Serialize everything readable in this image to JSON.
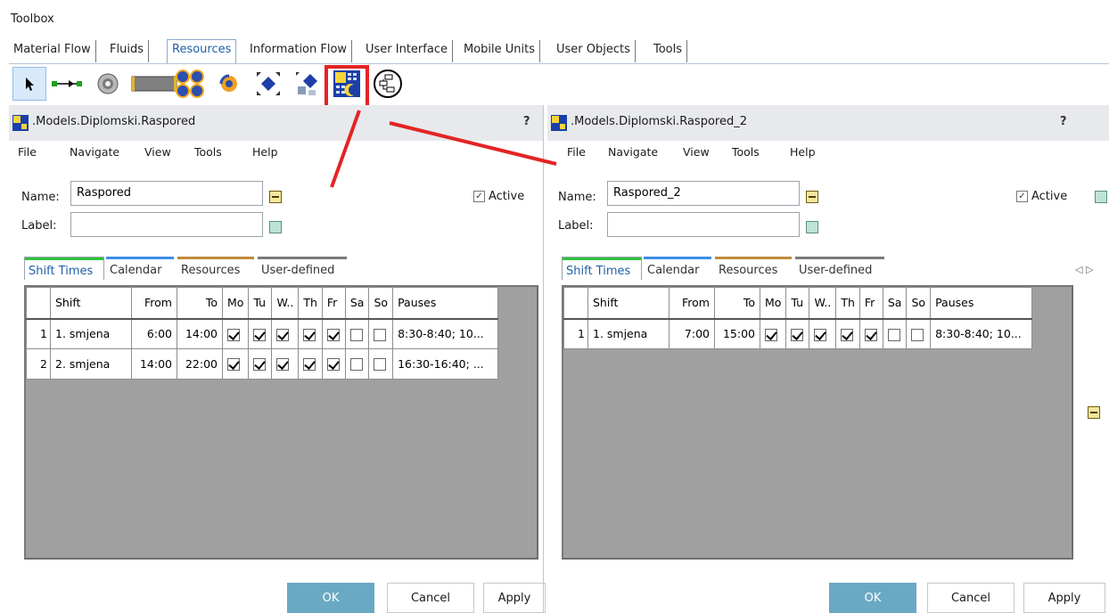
{
  "toolbox": {
    "title": "Toolbox",
    "tabs": [
      "Material Flow",
      "Fluids",
      "Resources",
      "Information Flow",
      "User Interface",
      "Mobile Units",
      "User Objects",
      "Tools"
    ],
    "active_tab": "Resources"
  },
  "tools": [
    "pointer-icon",
    "connector-icon",
    "worker-pool-icon",
    "broker-icon",
    "exporter-icon",
    "footpath-icon",
    "worker-icon",
    "exchange-icon",
    "shift-calendar-icon",
    "workplace-icon"
  ],
  "windows": [
    {
      "title": ".Models.Diplomski.Raspored",
      "help": "?",
      "menu": [
        "File",
        "Navigate",
        "View",
        "Tools",
        "Help"
      ],
      "name_label": "Name:",
      "name_value": "Raspored",
      "label_label": "Label:",
      "label_value": "",
      "active_label": "Active",
      "tabs": [
        "Shift Times",
        "Calendar",
        "Resources",
        "User-defined"
      ],
      "columns": [
        "Shift",
        "From",
        "To",
        "Mo",
        "Tu",
        "W..",
        "Th",
        "Fr",
        "Sa",
        "So",
        "Pauses"
      ],
      "rows": [
        {
          "n": "1",
          "shift": "1. smjena",
          "from": "6:00",
          "to": "14:00",
          "days": [
            true,
            true,
            true,
            true,
            true,
            false,
            false
          ],
          "pauses": "8:30-8:40; 10..."
        },
        {
          "n": "2",
          "shift": "2. smjena",
          "from": "14:00",
          "to": "22:00",
          "days": [
            true,
            true,
            true,
            true,
            true,
            false,
            false
          ],
          "pauses": "16:30-16:40; ..."
        }
      ],
      "buttons": {
        "ok": "OK",
        "cancel": "Cancel",
        "apply": "Apply"
      }
    },
    {
      "title": ".Models.Diplomski.Raspored_2",
      "help": "?",
      "menu": [
        "File",
        "Navigate",
        "View",
        "Tools",
        "Help"
      ],
      "name_label": "Name:",
      "name_value": "Raspored_2",
      "label_label": "Label:",
      "label_value": "",
      "active_label": "Active",
      "tabs": [
        "Shift Times",
        "Calendar",
        "Resources",
        "User-defined"
      ],
      "columns": [
        "Shift",
        "From",
        "To",
        "Mo",
        "Tu",
        "W..",
        "Th",
        "Fr",
        "Sa",
        "So",
        "Pauses"
      ],
      "rows": [
        {
          "n": "1",
          "shift": "1. smjena",
          "from": "7:00",
          "to": "15:00",
          "days": [
            true,
            true,
            true,
            true,
            true,
            false,
            false
          ],
          "pauses": "8:30-8:40; 10..."
        }
      ],
      "buttons": {
        "ok": "OK",
        "cancel": "Cancel",
        "apply": "Apply"
      }
    }
  ],
  "colors": {
    "tab_shift_times": "#2ec43a",
    "tab_calendar": "#3d8ee8",
    "tab_resources": "#c08a3c",
    "tab_user_defined": "#7a7a7a",
    "highlight": "#e32424",
    "ok_button": "#6aa9c4"
  }
}
